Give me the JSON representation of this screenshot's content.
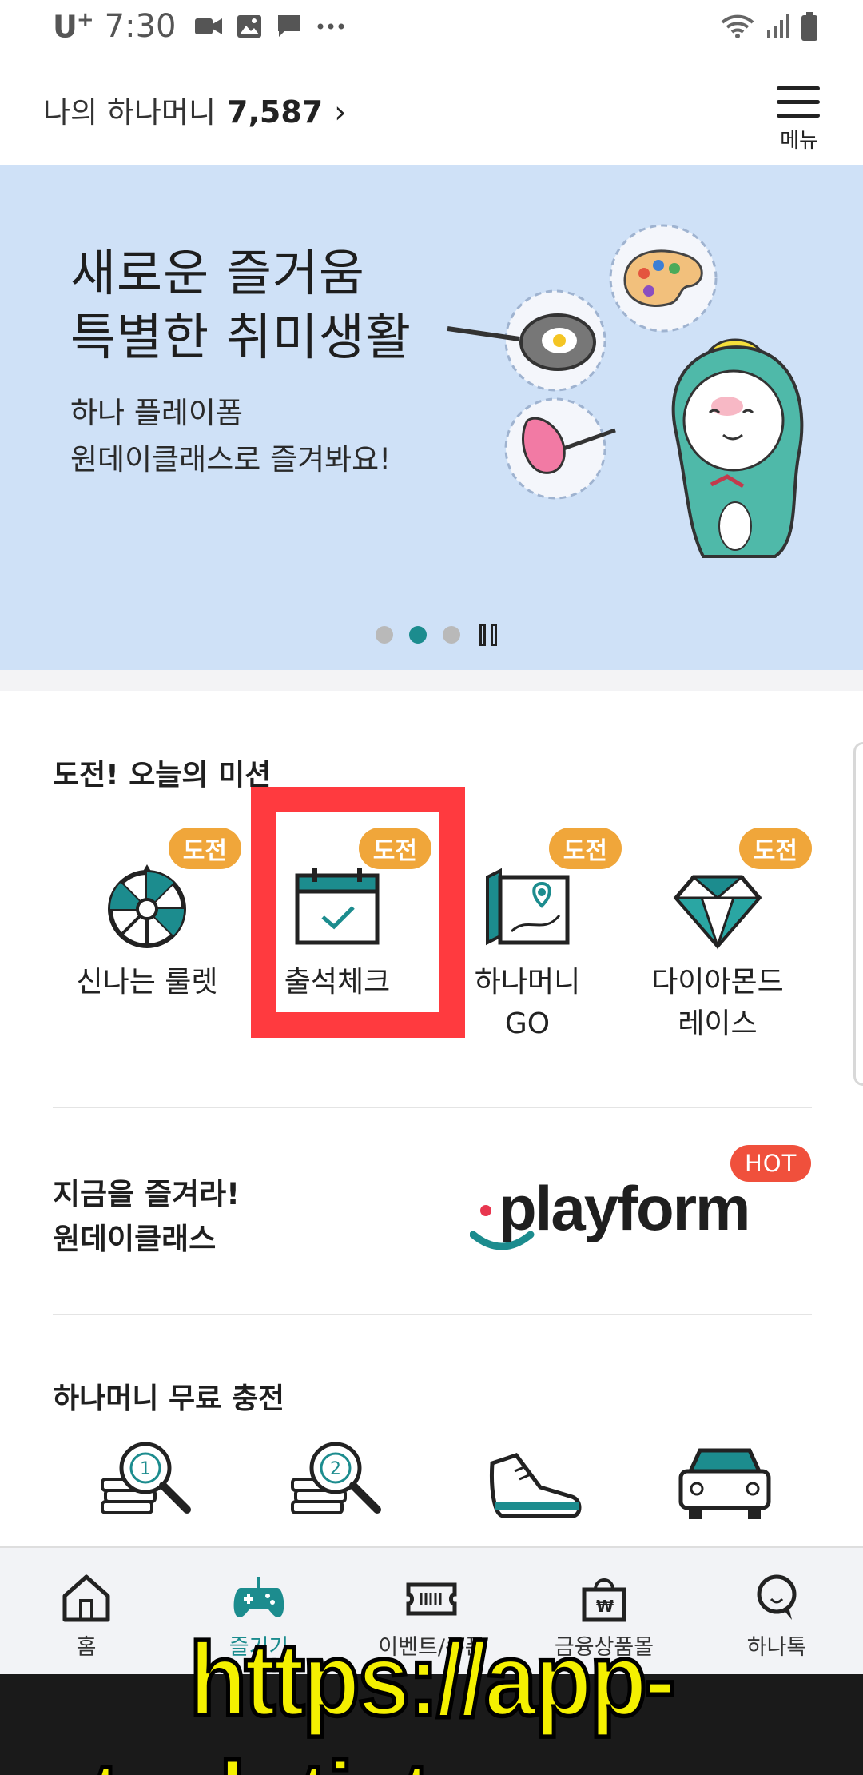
{
  "status_bar": {
    "carrier": "U",
    "carrier_sup": "+",
    "time": "7:30",
    "left_icons": [
      "video-icon",
      "image-icon",
      "chat-icon",
      "more-icon"
    ],
    "right_icons": [
      "wifi-icon",
      "signal-icon",
      "battery-icon"
    ]
  },
  "header": {
    "money_label": "나의 하나머니",
    "money_amount": "7,587",
    "chevron": "›",
    "menu_label": "메뉴"
  },
  "banner": {
    "title": "새로운 즐거움\n특별한 취미생활",
    "subtitle": "하나 플레이폼\n원데이클래스로 즐겨봐요!",
    "pager": {
      "count": 3,
      "active_index": 1
    },
    "bg_color": "#cfe1f7"
  },
  "missions": {
    "title": "도전! 오늘의 미션",
    "badge_color": "#f0a63a",
    "items": [
      {
        "label": "신나는 룰렛",
        "badge": "도전",
        "icon": "roulette-icon"
      },
      {
        "label": "출석체크",
        "badge": "도전",
        "icon": "calendar-check-icon"
      },
      {
        "label": "하나머니\nGO",
        "badge": "도전",
        "icon": "map-pin-icon"
      },
      {
        "label": "다이아몬드\n레이스",
        "badge": "도전",
        "icon": "diamond-icon"
      }
    ],
    "highlight_color": "#ff3a3f"
  },
  "promo": {
    "text": "지금을 즐겨라!\n원데이클래스",
    "logo_text": "playform",
    "hot_badge": "HOT"
  },
  "charge": {
    "title": "하나머니 무료 충전",
    "icons": [
      "coin-search-1-icon",
      "coin-search-2-icon",
      "sneaker-icon",
      "car-icon"
    ]
  },
  "bottom_nav": {
    "accent_color": "#1c8c8e",
    "items": [
      {
        "label": "홈",
        "icon": "home-icon"
      },
      {
        "label": "즐기기",
        "icon": "gamepad-icon",
        "active": true
      },
      {
        "label": "이벤트/쿠폰",
        "icon": "coupon-icon"
      },
      {
        "label": "금융상품몰",
        "icon": "shopping-bag-icon"
      },
      {
        "label": "하나톡",
        "icon": "chat-bubble-icon"
      }
    ]
  },
  "watermark": "https://app-tech.tistory.com"
}
